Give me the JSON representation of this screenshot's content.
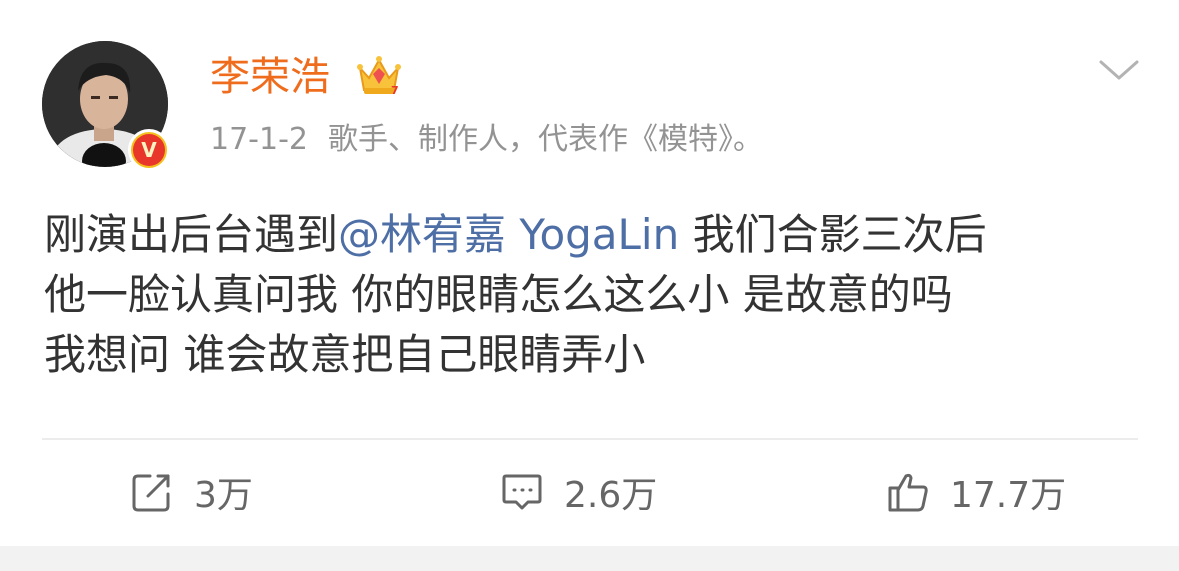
{
  "post": {
    "author": {
      "name": "李荣浩",
      "avatar_icon": "avatar-photo",
      "verified_badge": "V",
      "member_icon": "crown-icon",
      "accent_color": "#f06c1d"
    },
    "time": "17-1-2",
    "bio": "歌手、制作人，代表作《模特》。",
    "text": {
      "line1_before": "刚演出后台遇到",
      "mention": "@林宥嘉 YogaLin",
      "line1_after": " 我们合影三次后",
      "line2": "他一脸认真问我 你的眼睛怎么这么小 是故意的吗",
      "line3": "我想问 谁会故意把自己眼睛弄小"
    },
    "mention_color": "#4e6ea6",
    "menu_icon": "chevron-down-icon"
  },
  "actions": {
    "repost": {
      "icon": "repost-icon",
      "count": "3万"
    },
    "comment": {
      "icon": "comment-icon",
      "count": "2.6万"
    },
    "like": {
      "icon": "thumbs-up-icon",
      "count": "17.7万"
    }
  }
}
